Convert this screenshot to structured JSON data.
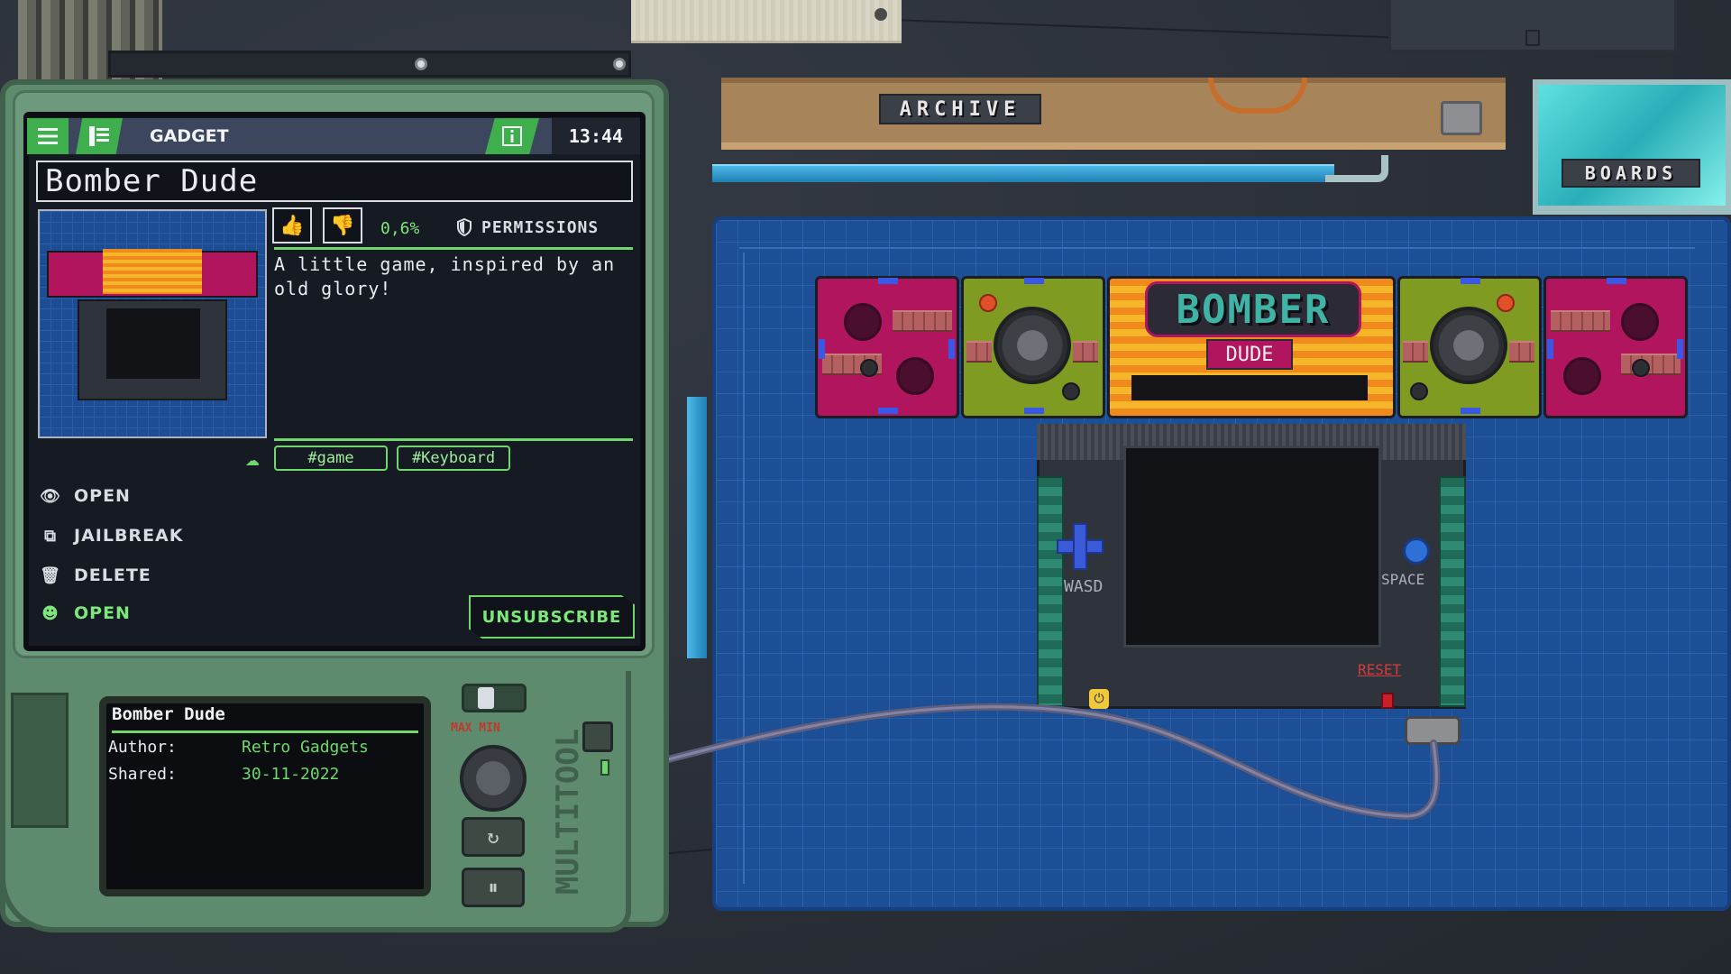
{
  "scene": {
    "archive_label": "ARCHIVE",
    "boards_label": "BOARDS"
  },
  "console": {
    "logo_top": "BOMBER",
    "logo_bottom": "DUDE",
    "wasd_label": "WASD",
    "space_label": "SPACE",
    "reset_label": "RESET"
  },
  "device": {
    "header": {
      "menu_icon": "hamburger-icon",
      "list_icon": "list-icon",
      "title": "GADGET",
      "info_icon": "info-icon",
      "time": "13:44"
    },
    "gadget_name": "Bomber Dude",
    "rating": "0,6%",
    "permissions_label": "PERMISSIONS",
    "description": "A little game, inspired by an old glory!",
    "tags": [
      "#game",
      "#Keyboard"
    ],
    "menu": {
      "open": "OPEN",
      "jailbreak": "JAILBREAK",
      "delete": "DELETE",
      "open_subscribed": "OPEN"
    },
    "unsubscribe_label": "UNSUBSCRIBE",
    "info": {
      "title": "Bomber Dude",
      "author_key": "Author:",
      "author_value": "Retro Gadgets",
      "shared_key": "Shared:",
      "shared_value": "30-11-2022"
    },
    "knob_label": "MAX MIN",
    "side_text": "MULTITOOL"
  },
  "colors": {
    "accent_green": "#6ed86d",
    "header_green": "#3fae4c",
    "screen_bg": "#161a23",
    "shell": "#5e8a6d",
    "mat_blue": "#1d4f96"
  }
}
